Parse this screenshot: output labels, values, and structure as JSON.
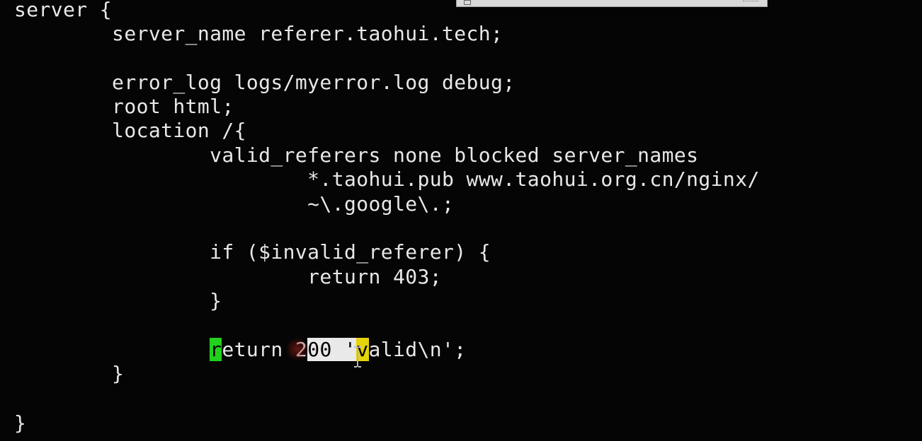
{
  "terminal": {
    "lines": {
      "l1": "server {",
      "l2": "        server_name referer.taohui.tech;",
      "l3": "        error_log logs/myerror.log debug;",
      "l4": "        root html;",
      "l5": "        location /{",
      "l6": "                valid_referers none blocked server_names",
      "l7": "                        *.taohui.pub www.taohui.org.cn/nginx/",
      "l8": "                        ~\\.google\\.;",
      "l9": "                if ($invalid_referer) {",
      "l10": "                        return 403;",
      "l11": "                }",
      "l12": {
        "indent": "                ",
        "cursor_char": "r",
        "a": "eturn 2",
        "sel1": "00 '",
        "sel2": "v",
        "b": "alid\\n';"
      },
      "l13": "        }",
      "l14": "}"
    },
    "colors": {
      "background": "#050505",
      "text": "#e8e8e8",
      "cursor": "#22d11c",
      "selection": "#e9e9e9",
      "selection_highlight": "#e6d40a"
    }
  },
  "icons": {
    "mouse": "i-beam-cursor-icon",
    "click": "click-indicator-icon"
  }
}
